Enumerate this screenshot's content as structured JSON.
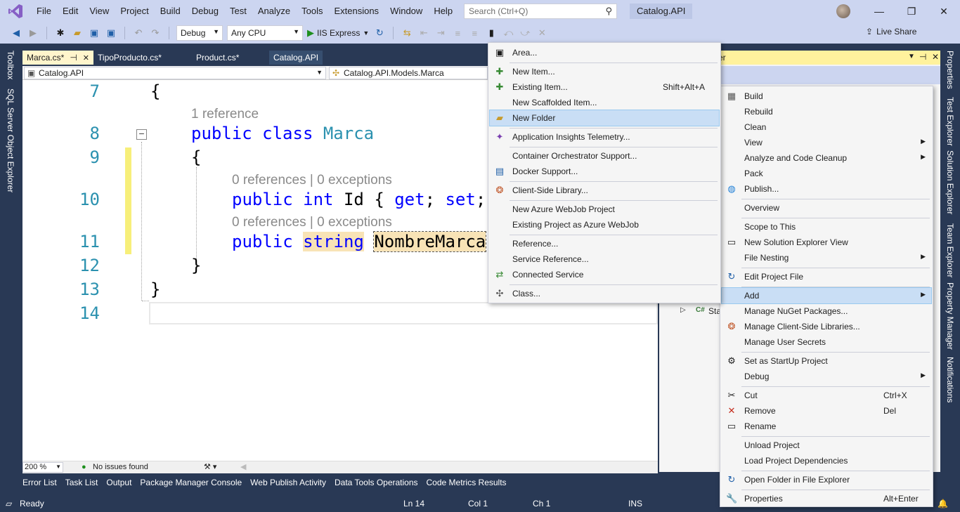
{
  "menubar": {
    "items": [
      "File",
      "Edit",
      "View",
      "Project",
      "Build",
      "Debug",
      "Test",
      "Analyze",
      "Tools",
      "Extensions",
      "Window",
      "Help"
    ],
    "search_placeholder": "Search (Ctrl+Q)",
    "solution_name": "Catalog.API"
  },
  "toolbar": {
    "configuration": "Debug",
    "platform": "Any CPU",
    "run_label": "IIS Express",
    "live_share": "Live Share"
  },
  "left_rail": {
    "toolbox": "Toolbox",
    "sql_explorer": "SQL Server Object Explorer"
  },
  "right_rail": {
    "properties": "Properties",
    "test_explorer": "Test Explorer",
    "solution_explorer": "Solution Explorer",
    "team_explorer": "Team Explorer",
    "property_manager": "Property Manager",
    "notifications": "Notifications"
  },
  "editor": {
    "tabs": [
      {
        "label": "Marca.cs*",
        "pin": "⊣",
        "close": "✕"
      },
      {
        "label": "TipoProducto.cs*"
      },
      {
        "label": "Product.cs*"
      },
      {
        "label": "Catalog.API"
      }
    ],
    "nav_project": "Catalog.API",
    "nav_type": "Catalog.API.Models.Marca",
    "line_numbers": [
      "7",
      "8",
      "9",
      "10",
      "11",
      "12",
      "13",
      "14"
    ],
    "lens": {
      "class_refs": "1 reference",
      "prop1": "0 references | 0 exceptions",
      "prop2": "0 references | 0 exceptions"
    },
    "code": {
      "l7": "{",
      "l8_kw1": "public",
      "l8_kw2": "class",
      "l8_type": "Marca",
      "l9": "{",
      "l10_kw1": "public",
      "l10_kw2": "int",
      "l10_rest": " Id { ",
      "l10_get": "get",
      "l10_mid": "; ",
      "l10_set": "set",
      "l10_end": ";",
      "l11_kw1": "public",
      "l11_kw2": "string",
      "l11_name": "NombreMarca",
      "l12": "}",
      "l13": "}"
    },
    "zoom": "200 %",
    "issues": "No issues found"
  },
  "tool_tabs": [
    "Error List",
    "Task List",
    "Output",
    "Package Manager Console",
    "Web Publish Activity",
    "Data Tools Operations",
    "Code Metrics Results"
  ],
  "statusbar": {
    "ready": "Ready",
    "ln": "Ln 14",
    "col": "Col 1",
    "ch": "Ch 1",
    "ins": "INS"
  },
  "solution_explorer": {
    "title_fragment": "er",
    "node_fragment": "Sta"
  },
  "context_menu": {
    "items": [
      {
        "label": "Build",
        "icon": "build-icon",
        "glyph": "▦"
      },
      {
        "label": "Rebuild"
      },
      {
        "label": "Clean"
      },
      {
        "label": "View",
        "submenu": "▶"
      },
      {
        "label": "Analyze and Code Cleanup",
        "submenu": "▶"
      },
      {
        "label": "Pack"
      },
      {
        "label": "Publish...",
        "icon": "globe-icon",
        "glyph": "◍"
      },
      {
        "label": "Overview"
      },
      {
        "label": "Scope to This"
      },
      {
        "label": "New Solution Explorer View",
        "icon": "window-icon",
        "glyph": "▭"
      },
      {
        "label": "File Nesting",
        "submenu": "▶"
      },
      {
        "label": "Edit Project File",
        "icon": "refresh-icon",
        "glyph": "↻"
      },
      {
        "label": "Add",
        "submenu": "▶"
      },
      {
        "label": "Manage NuGet Packages..."
      },
      {
        "label": "Manage Client-Side Libraries...",
        "icon": "library-icon",
        "glyph": "❂"
      },
      {
        "label": "Manage User Secrets"
      },
      {
        "label": "Set as StartUp Project",
        "icon": "gear-icon",
        "glyph": "⚙"
      },
      {
        "label": "Debug",
        "submenu": "▶"
      },
      {
        "label": "Cut",
        "icon": "scissors-icon",
        "glyph": "✂",
        "shortcut": "Ctrl+X"
      },
      {
        "label": "Remove",
        "icon": "remove-icon",
        "glyph": "✕",
        "shortcut": "Del"
      },
      {
        "label": "Rename",
        "icon": "rename-icon",
        "glyph": "▭"
      },
      {
        "label": "Unload Project"
      },
      {
        "label": "Load Project Dependencies"
      },
      {
        "label": "Open Folder in File Explorer",
        "icon": "refresh-icon",
        "glyph": "↻"
      },
      {
        "label": "Properties",
        "icon": "wrench-icon",
        "glyph": "🔧",
        "shortcut": "Alt+Enter"
      }
    ]
  },
  "add_menu": {
    "items": [
      {
        "label": "Area...",
        "glyph": "▣"
      },
      {
        "label": "New Item...",
        "glyph": "✚"
      },
      {
        "label": "Existing Item...",
        "glyph": "✚",
        "shortcut": "Shift+Alt+A"
      },
      {
        "label": "New Scaffolded Item..."
      },
      {
        "label": "New Folder",
        "glyph": "▰"
      },
      {
        "label": "Application Insights Telemetry...",
        "glyph": "✦"
      },
      {
        "label": "Container Orchestrator Support..."
      },
      {
        "label": "Docker Support...",
        "glyph": "▤"
      },
      {
        "label": "Client-Side Library...",
        "glyph": "❂"
      },
      {
        "label": "New Azure WebJob Project"
      },
      {
        "label": "Existing Project as Azure WebJob"
      },
      {
        "label": "Reference..."
      },
      {
        "label": "Service Reference..."
      },
      {
        "label": "Connected Service",
        "glyph": "⇄"
      },
      {
        "label": "Class...",
        "glyph": "✣"
      }
    ]
  },
  "colors": {
    "accent": "#293955",
    "menu_bg": "#ccd5f0",
    "highlight": "#c9def5",
    "keyword": "#0000ff",
    "type": "#2b91af"
  }
}
